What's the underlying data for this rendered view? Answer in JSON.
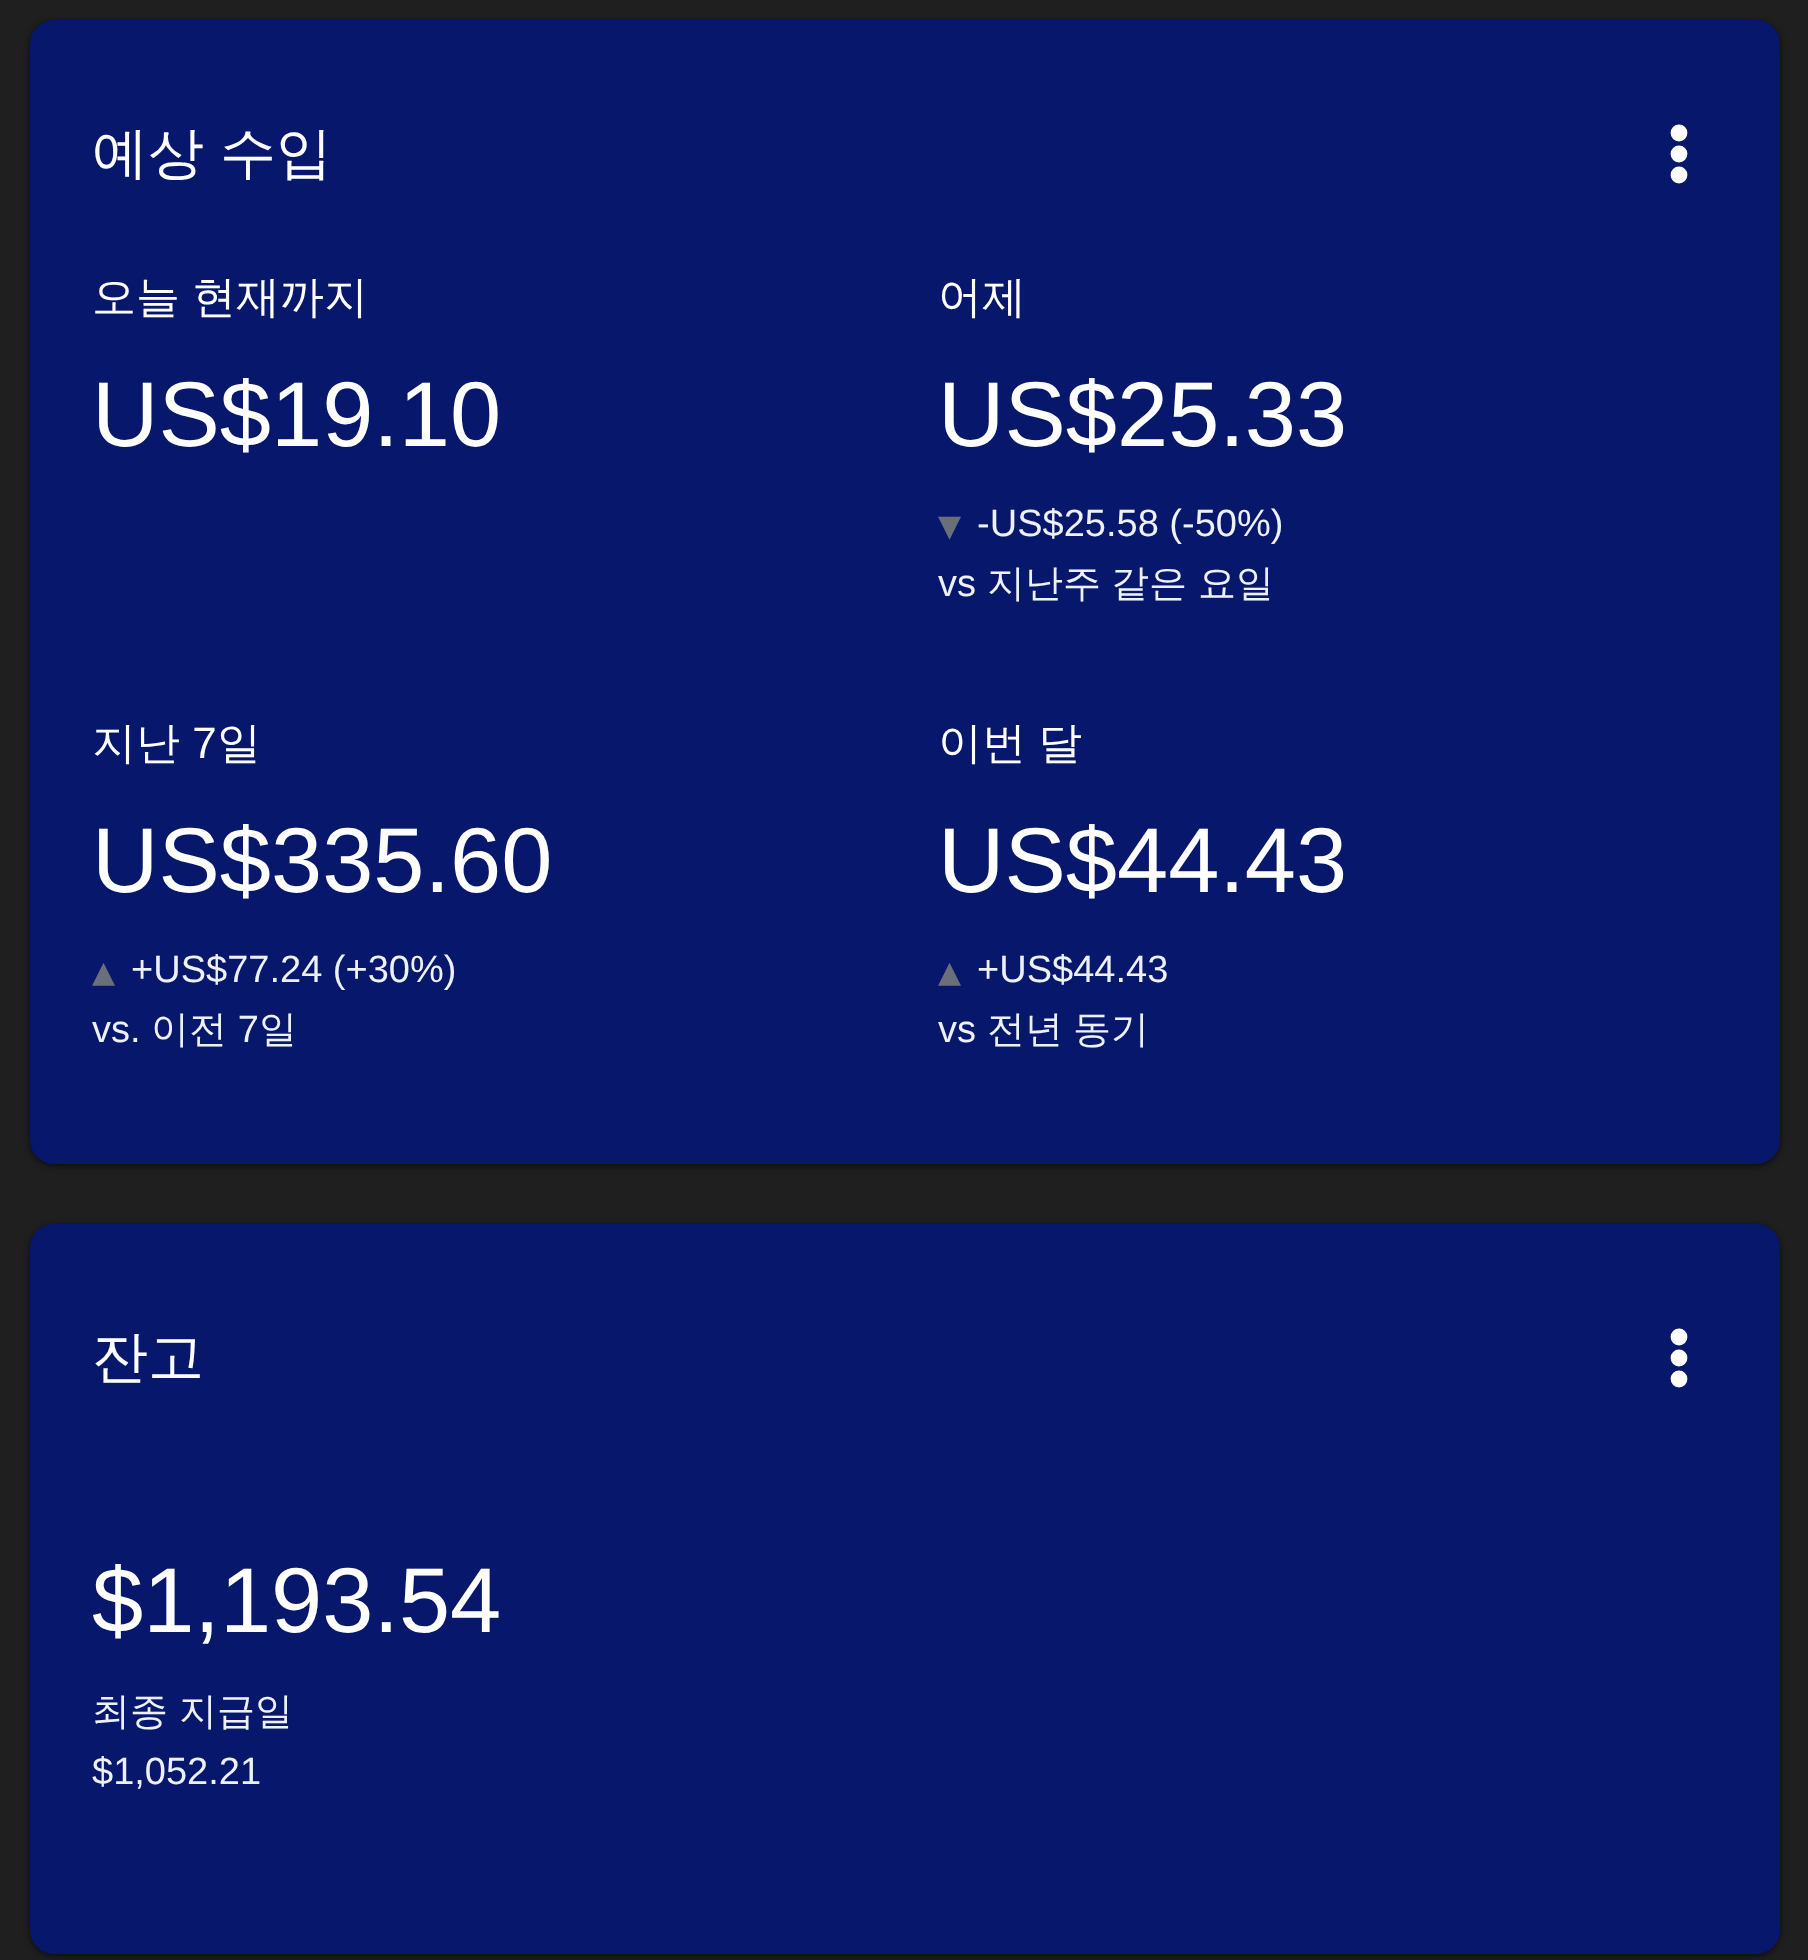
{
  "estimated_earnings": {
    "title": "예상 수입",
    "stats": [
      {
        "label": "오늘 현재까지",
        "value": "US$19.10"
      },
      {
        "label": "어제",
        "value": "US$25.33",
        "change": {
          "arrow": "▼",
          "text": "-US$25.58 (-50%)"
        },
        "comparison": "vs 지난주 같은 요일"
      },
      {
        "label": "지난 7일",
        "value": "US$335.60",
        "change": {
          "arrow": "▲",
          "text": "+US$77.24 (+30%)"
        },
        "comparison": "vs. 이전 7일"
      },
      {
        "label": "이번 달",
        "value": "US$44.43",
        "change": {
          "arrow": "▲",
          "text": "+US$44.43"
        },
        "comparison": "vs 전년 동기"
      }
    ]
  },
  "balance": {
    "title": "잔고",
    "amount": "$1,193.54",
    "last_payment": {
      "label": "최종 지급일",
      "amount": "$1,052.21"
    }
  }
}
